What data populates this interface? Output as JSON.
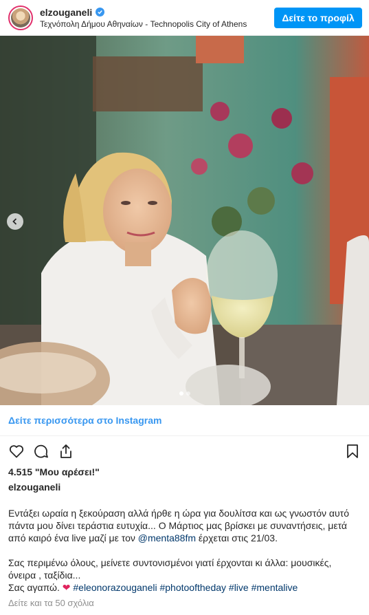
{
  "header": {
    "username": "elzouganeli",
    "location": "Τεχνόπολη Δήμου Αθηναίων - Technopolis City of Athens",
    "profile_button": "Δείτε το προφίλ"
  },
  "post": {
    "more_link": "Δείτε περισσότερα στο Instagram",
    "likes": "4.515 \"Μου αρέσει!\"",
    "caption_user": "elzouganeli",
    "caption_lines": {
      "line1": "Εντάξει ωραία η ξεκούραση αλλά ήρθε η ώρα για δουλίτσα και ως γνωστόν αυτό",
      "line2": "πάντα μου δίνει τεράστια ευτυχία... Ο Μάρτιος μας βρίσκει με συναντήσεις, μετά",
      "line3_prefix": "από καιρό ένα live μαζί με τον ",
      "line3_mention": "@menta88fm",
      "line3_suffix": " έρχεται στις 21/03.",
      "line4": "Σας περιμένω όλους, μείνετε συντονισμένοι γιατί έρχονται κι άλλα: μουσικές,",
      "line5": "όνειρα , ταξίδια...",
      "line6_prefix": "Σας αγαπώ. ",
      "line6_heart": "❤"
    },
    "hashtags": [
      "#eleonorazouganeli",
      "#photooftheday",
      "#live",
      "#mentalive"
    ],
    "comments_link": "Δείτε και τα 50 σχόλια"
  },
  "carousel": {
    "dot_count": 2,
    "active_index": 0
  },
  "icons": {
    "verified": "verified-badge-icon",
    "like": "heart-icon",
    "comment": "comment-icon",
    "share": "share-icon",
    "save": "bookmark-icon",
    "prev": "chevron-left-icon"
  },
  "colors": {
    "accent": "#0095f6",
    "link": "#3897f0",
    "hashtag": "#00376b",
    "muted": "#8e8e8e"
  }
}
